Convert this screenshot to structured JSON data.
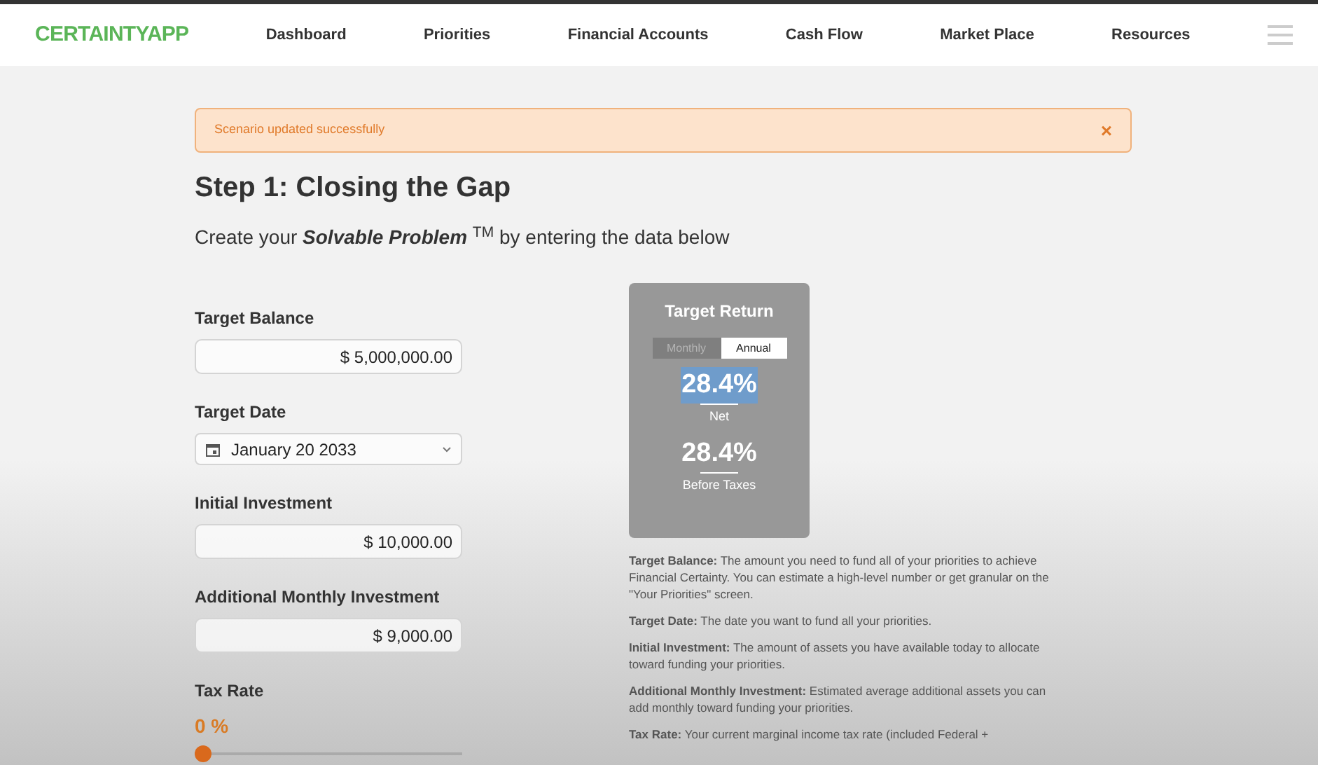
{
  "brand": "CERTAINTYAPP",
  "nav": [
    {
      "label": "Dashboard"
    },
    {
      "label": "Priorities"
    },
    {
      "label": "Financial Accounts"
    },
    {
      "label": "Cash Flow"
    },
    {
      "label": "Market Place"
    },
    {
      "label": "Resources"
    }
  ],
  "alert": {
    "message": "Scenario updated successfully",
    "close": "×"
  },
  "title": "Step 1: Closing the Gap",
  "subtitle": "Create your **Solvable Problem** $^{TM}$ by entering the data below",
  "fields": [
    {
      "kind": "input",
      "label": "Target Balance",
      "value": "$ 5,000,000.00"
    },
    {
      "kind": "date",
      "label": "Target Date",
      "value": "January 20 2033"
    },
    {
      "kind": "input",
      "label": "Initial Investment",
      "value": "$ 10,000.00"
    },
    {
      "kind": "input",
      "label": "Additional Monthly Investment",
      "value": "$ 9,000.00"
    },
    {
      "kind": "slider",
      "label": "Tax Rate",
      "value": "0 %",
      "level": 0
    }
  ],
  "target_return": {
    "title": "Target Return",
    "tabs": [
      {
        "label": "Monthly",
        "selected": false
      },
      {
        "label": "Annual",
        "selected": true
      }
    ],
    "metrics": [
      {
        "value": "28.4%",
        "label": "Net",
        "highlighted": true
      },
      {
        "value": "28.4%",
        "label": "Before Taxes",
        "highlighted": false
      }
    ]
  },
  "help": [
    "**Target Balance:** The amount you need to fund all of your priorities to achieve Financial Certainty. You can estimate a high-level number or get granular on the \"Your Priorities\" screen.",
    "**Target Date:** The date you want to fund all your priorities.",
    "**Initial Investment:** The amount of assets you have available today to allocate toward funding your priorities.",
    "**Additional Monthly Investment:** Estimated average additional assets you can add monthly toward funding your priorities.",
    "**Tax Rate:** Your current marginal income tax rate (included Federal +"
  ]
}
